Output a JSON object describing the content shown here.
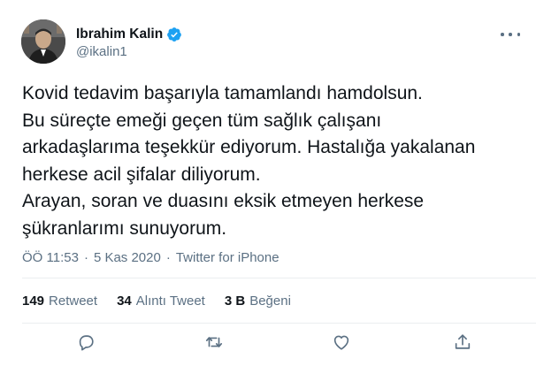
{
  "author": {
    "name": "Ibrahim Kalin",
    "handle": "@ikalin1",
    "verified": true,
    "avatar": "profile-photo"
  },
  "tweet": {
    "lines": [
      "Kovid tedavim başarıyla tamamlandı hamdolsun.",
      "Bu süreçte emeği geçen tüm sağlık çalışanı",
      "arkadaşlarıma teşekkür ediyorum. Hastalığa yakalanan",
      "herkese acil şifalar diliyorum.",
      "Arayan, soran ve duasını eksik etmeyen herkese",
      "şükranlarımı sunuyorum."
    ]
  },
  "meta": {
    "time": "ÖÖ 11:53",
    "date": "5 Kas 2020",
    "source": "Twitter for iPhone",
    "separator": "·"
  },
  "stats": {
    "retweets": {
      "count": "149",
      "label": "Retweet"
    },
    "quotes": {
      "count": "34",
      "label": "Alıntı Tweet"
    },
    "likes": {
      "count": "3 B",
      "label": "Beğeni"
    }
  },
  "actions": [
    "reply-icon",
    "retweet-icon",
    "like-icon",
    "share-icon"
  ],
  "colors": {
    "accent": "#1da1f2",
    "text": "#0f1419",
    "secondary": "#5b7083",
    "divider": "#ebeef0"
  }
}
